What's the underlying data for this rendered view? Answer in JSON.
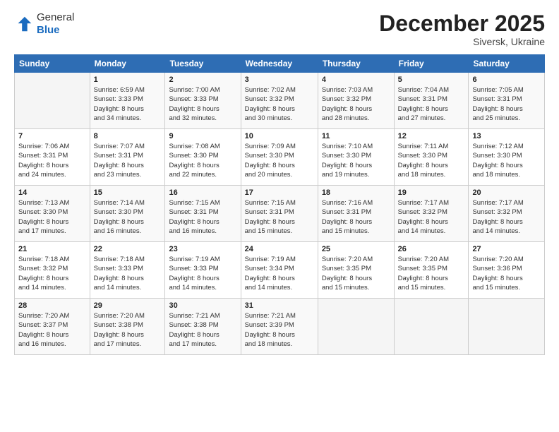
{
  "logo": {
    "general": "General",
    "blue": "Blue"
  },
  "header": {
    "month": "December 2025",
    "location": "Siversk, Ukraine"
  },
  "days_of_week": [
    "Sunday",
    "Monday",
    "Tuesday",
    "Wednesday",
    "Thursday",
    "Friday",
    "Saturday"
  ],
  "weeks": [
    [
      {
        "day": "",
        "info": ""
      },
      {
        "day": "1",
        "info": "Sunrise: 6:59 AM\nSunset: 3:33 PM\nDaylight: 8 hours\nand 34 minutes."
      },
      {
        "day": "2",
        "info": "Sunrise: 7:00 AM\nSunset: 3:33 PM\nDaylight: 8 hours\nand 32 minutes."
      },
      {
        "day": "3",
        "info": "Sunrise: 7:02 AM\nSunset: 3:32 PM\nDaylight: 8 hours\nand 30 minutes."
      },
      {
        "day": "4",
        "info": "Sunrise: 7:03 AM\nSunset: 3:32 PM\nDaylight: 8 hours\nand 28 minutes."
      },
      {
        "day": "5",
        "info": "Sunrise: 7:04 AM\nSunset: 3:31 PM\nDaylight: 8 hours\nand 27 minutes."
      },
      {
        "day": "6",
        "info": "Sunrise: 7:05 AM\nSunset: 3:31 PM\nDaylight: 8 hours\nand 25 minutes."
      }
    ],
    [
      {
        "day": "7",
        "info": "Sunrise: 7:06 AM\nSunset: 3:31 PM\nDaylight: 8 hours\nand 24 minutes."
      },
      {
        "day": "8",
        "info": "Sunrise: 7:07 AM\nSunset: 3:31 PM\nDaylight: 8 hours\nand 23 minutes."
      },
      {
        "day": "9",
        "info": "Sunrise: 7:08 AM\nSunset: 3:30 PM\nDaylight: 8 hours\nand 22 minutes."
      },
      {
        "day": "10",
        "info": "Sunrise: 7:09 AM\nSunset: 3:30 PM\nDaylight: 8 hours\nand 20 minutes."
      },
      {
        "day": "11",
        "info": "Sunrise: 7:10 AM\nSunset: 3:30 PM\nDaylight: 8 hours\nand 19 minutes."
      },
      {
        "day": "12",
        "info": "Sunrise: 7:11 AM\nSunset: 3:30 PM\nDaylight: 8 hours\nand 18 minutes."
      },
      {
        "day": "13",
        "info": "Sunrise: 7:12 AM\nSunset: 3:30 PM\nDaylight: 8 hours\nand 18 minutes."
      }
    ],
    [
      {
        "day": "14",
        "info": "Sunrise: 7:13 AM\nSunset: 3:30 PM\nDaylight: 8 hours\nand 17 minutes."
      },
      {
        "day": "15",
        "info": "Sunrise: 7:14 AM\nSunset: 3:30 PM\nDaylight: 8 hours\nand 16 minutes."
      },
      {
        "day": "16",
        "info": "Sunrise: 7:15 AM\nSunset: 3:31 PM\nDaylight: 8 hours\nand 16 minutes."
      },
      {
        "day": "17",
        "info": "Sunrise: 7:15 AM\nSunset: 3:31 PM\nDaylight: 8 hours\nand 15 minutes."
      },
      {
        "day": "18",
        "info": "Sunrise: 7:16 AM\nSunset: 3:31 PM\nDaylight: 8 hours\nand 15 minutes."
      },
      {
        "day": "19",
        "info": "Sunrise: 7:17 AM\nSunset: 3:32 PM\nDaylight: 8 hours\nand 14 minutes."
      },
      {
        "day": "20",
        "info": "Sunrise: 7:17 AM\nSunset: 3:32 PM\nDaylight: 8 hours\nand 14 minutes."
      }
    ],
    [
      {
        "day": "21",
        "info": "Sunrise: 7:18 AM\nSunset: 3:32 PM\nDaylight: 8 hours\nand 14 minutes."
      },
      {
        "day": "22",
        "info": "Sunrise: 7:18 AM\nSunset: 3:33 PM\nDaylight: 8 hours\nand 14 minutes."
      },
      {
        "day": "23",
        "info": "Sunrise: 7:19 AM\nSunset: 3:33 PM\nDaylight: 8 hours\nand 14 minutes."
      },
      {
        "day": "24",
        "info": "Sunrise: 7:19 AM\nSunset: 3:34 PM\nDaylight: 8 hours\nand 14 minutes."
      },
      {
        "day": "25",
        "info": "Sunrise: 7:20 AM\nSunset: 3:35 PM\nDaylight: 8 hours\nand 15 minutes."
      },
      {
        "day": "26",
        "info": "Sunrise: 7:20 AM\nSunset: 3:35 PM\nDaylight: 8 hours\nand 15 minutes."
      },
      {
        "day": "27",
        "info": "Sunrise: 7:20 AM\nSunset: 3:36 PM\nDaylight: 8 hours\nand 15 minutes."
      }
    ],
    [
      {
        "day": "28",
        "info": "Sunrise: 7:20 AM\nSunset: 3:37 PM\nDaylight: 8 hours\nand 16 minutes."
      },
      {
        "day": "29",
        "info": "Sunrise: 7:20 AM\nSunset: 3:38 PM\nDaylight: 8 hours\nand 17 minutes."
      },
      {
        "day": "30",
        "info": "Sunrise: 7:21 AM\nSunset: 3:38 PM\nDaylight: 8 hours\nand 17 minutes."
      },
      {
        "day": "31",
        "info": "Sunrise: 7:21 AM\nSunset: 3:39 PM\nDaylight: 8 hours\nand 18 minutes."
      },
      {
        "day": "",
        "info": ""
      },
      {
        "day": "",
        "info": ""
      },
      {
        "day": "",
        "info": ""
      }
    ]
  ]
}
